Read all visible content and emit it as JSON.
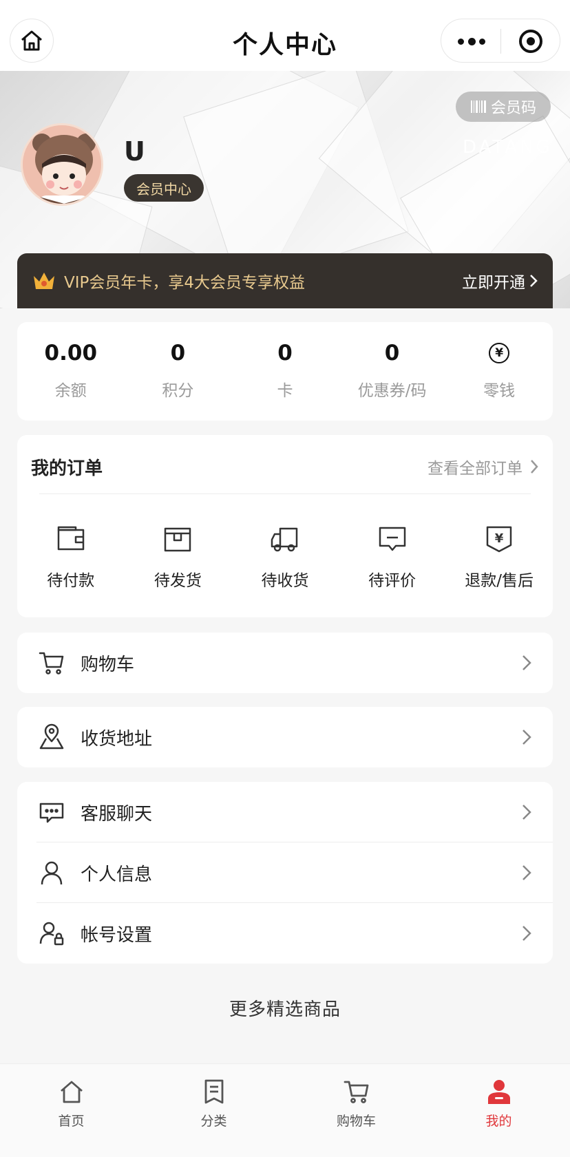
{
  "header": {
    "title": "个人中心",
    "icons": {
      "home": "home-icon",
      "more": "more-dots-icon",
      "close": "close-target-icon"
    }
  },
  "banner": {
    "member_code_label": "会员码",
    "brand": "DATANG",
    "username": "U",
    "member_center_label": "会员中心",
    "vip_text": "VIP会员年卡，享4大会员专享权益",
    "vip_action": "立即开通"
  },
  "stats": [
    {
      "value": "0.00",
      "label": "余额"
    },
    {
      "value": "0",
      "label": "积分"
    },
    {
      "value": "0",
      "label": "卡"
    },
    {
      "value": "0",
      "label": "优惠券/码"
    },
    {
      "value": "¥",
      "label": "零钱"
    }
  ],
  "orders": {
    "title": "我的订单",
    "view_all": "查看全部订单",
    "items": [
      {
        "label": "待付款",
        "icon": "wallet-icon"
      },
      {
        "label": "待发货",
        "icon": "box-icon"
      },
      {
        "label": "待收货",
        "icon": "truck-icon"
      },
      {
        "label": "待评价",
        "icon": "comment-icon"
      },
      {
        "label": "退款/售后",
        "icon": "refund-icon"
      }
    ]
  },
  "menu": {
    "cart": "购物车",
    "address": "收货地址",
    "service": "客服聊天",
    "profile": "个人信息",
    "account": "帐号设置"
  },
  "more_goods": "更多精选商品",
  "tabbar": {
    "items": [
      {
        "label": "首页",
        "icon": "home-icon"
      },
      {
        "label": "分类",
        "icon": "category-icon"
      },
      {
        "label": "购物车",
        "icon": "cart-icon"
      },
      {
        "label": "我的",
        "icon": "user-icon"
      }
    ],
    "active_color": "#e0373b"
  },
  "colors": {
    "vip_bar": "#35302c",
    "vip_text": "#e8c98e",
    "accent": "#e0373b"
  }
}
